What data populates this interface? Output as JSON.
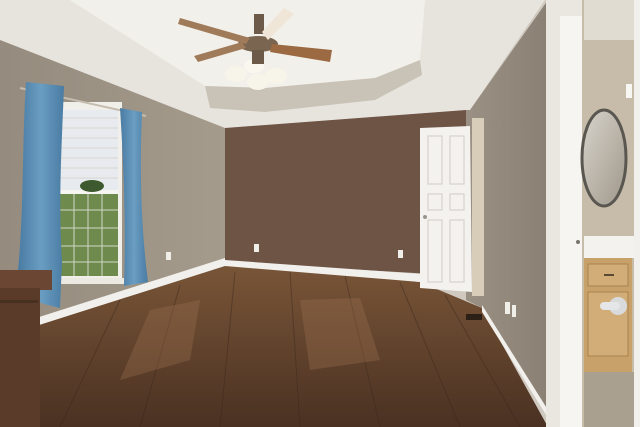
{
  "scene": {
    "type": "photo",
    "subject": "empty-bedroom-interior",
    "palette": {
      "ceiling": "#e9e7e2",
      "tray_ceiling": "#f1efea",
      "side_wall": "#8f8578",
      "side_wall_light": "#a09687",
      "accent_wall": "#6e5445",
      "floor_dark": "#3f2a1e",
      "floor_mid": "#6a4a33",
      "floor_light": "#8a6548",
      "baseboard": "#f2f0ec",
      "curtain": "#5b8db3",
      "door": "#f3f2ef",
      "bath_wall": "#c6bca9",
      "vanity": "#c7a06a",
      "dresser": "#5a3a28",
      "window_green": "#6f8a4d"
    }
  }
}
